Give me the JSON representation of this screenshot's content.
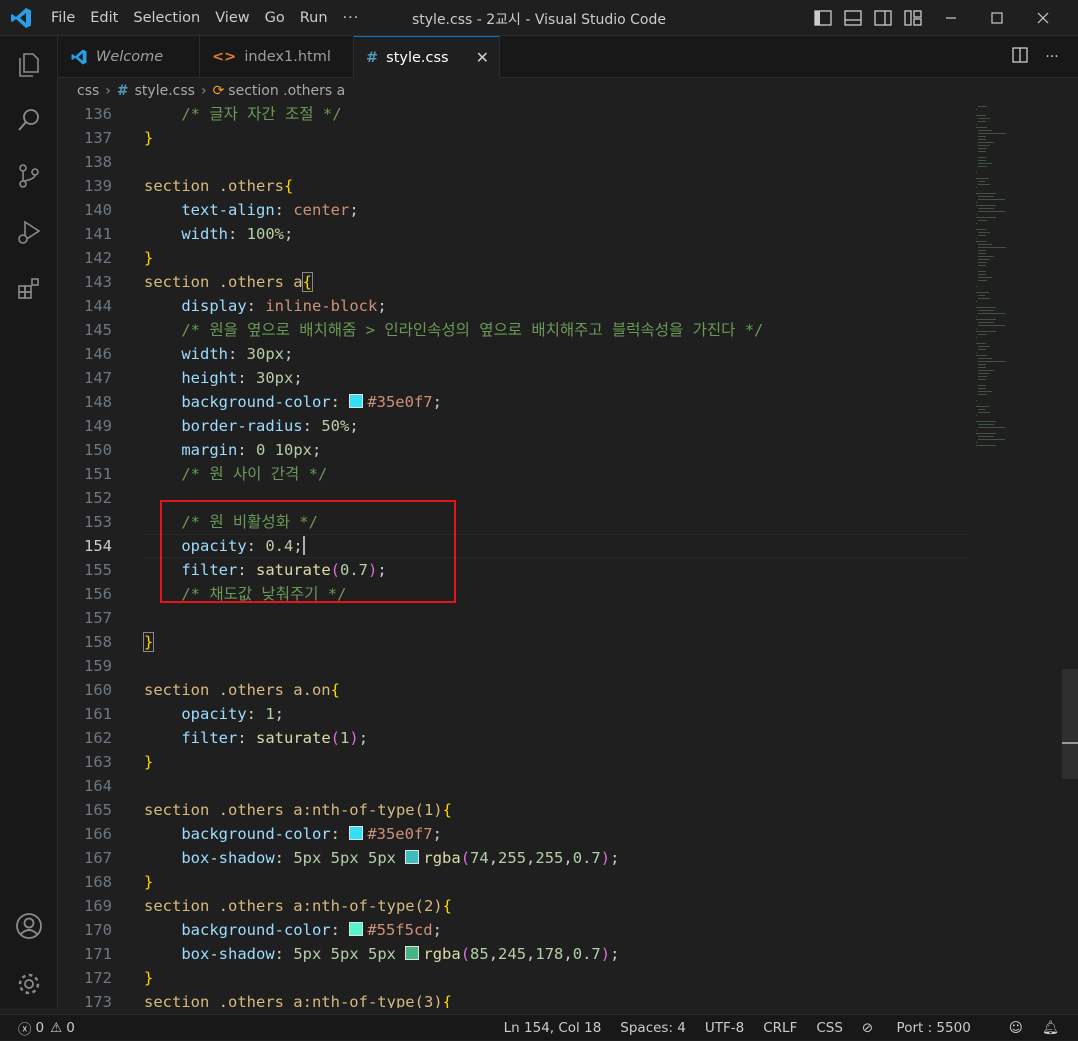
{
  "window": {
    "title": "style.css - 2교시 - Visual Studio Code"
  },
  "menu": [
    "File",
    "Edit",
    "Selection",
    "View",
    "Go",
    "Run",
    "···"
  ],
  "tabs": [
    {
      "label": "Welcome",
      "icon": "vscode-icon",
      "italic": true
    },
    {
      "label": "index1.html",
      "icon": "html-icon"
    },
    {
      "label": "style.css",
      "icon": "css-icon",
      "active": true
    }
  ],
  "breadcrumb": [
    "css",
    "style.css",
    "section .others a"
  ],
  "editor": {
    "current_line": 154,
    "lines": [
      {
        "n": "136",
        "html": "    <span class=\"cmt\">/* 글자 자간 조절 */</span>"
      },
      {
        "n": "137",
        "html": "<span class=\"br1\">}</span>"
      },
      {
        "n": "138",
        "html": ""
      },
      {
        "n": "139",
        "html": "<span class=\"sel\">section .others</span><span class=\"br1\">{</span>"
      },
      {
        "n": "140",
        "html": "    <span class=\"prop\">text-align</span>: <span class=\"val\">center</span>;"
      },
      {
        "n": "141",
        "html": "    <span class=\"prop\">width</span>: <span class=\"num\">100%</span>;"
      },
      {
        "n": "142",
        "html": "<span class=\"br1\">}</span>"
      },
      {
        "n": "143",
        "html": "<span class=\"sel\">section .others a</span><span class=\"br1 bracket-match\">{</span>"
      },
      {
        "n": "144",
        "html": "    <span class=\"prop\">display</span>: <span class=\"val\">inline-block</span>;"
      },
      {
        "n": "145",
        "html": "    <span class=\"cmt\">/* 원을 옆으로 배치해줌 &gt; 인라인속성의 옆으로 배치해주고 블럭속성을 가진다 */</span>"
      },
      {
        "n": "146",
        "html": "    <span class=\"prop\">width</span>: <span class=\"num\">30px</span>;"
      },
      {
        "n": "147",
        "html": "    <span class=\"prop\">height</span>: <span class=\"num\">30px</span>;"
      },
      {
        "n": "148",
        "html": "    <span class=\"prop\">background-color</span>: <span class=\"sw\" style=\"background:#35e0f7\"></span><span class=\"val\">#35e0f7</span>;"
      },
      {
        "n": "149",
        "html": "    <span class=\"prop\">border-radius</span>: <span class=\"num\">50%</span>;"
      },
      {
        "n": "150",
        "html": "    <span class=\"prop\">margin</span>: <span class=\"num\">0</span> <span class=\"num\">10px</span>;"
      },
      {
        "n": "151",
        "html": "    <span class=\"cmt\">/* 원 사이 간격 */</span>"
      },
      {
        "n": "152",
        "html": ""
      },
      {
        "n": "153",
        "html": "    <span class=\"cmt\">/* 원 비활성화 */</span>"
      },
      {
        "n": "154",
        "html": "    <span class=\"prop\">opacity</span>: <span class=\"num\">0.4</span>;<span class=\"caret\"></span>"
      },
      {
        "n": "155",
        "html": "    <span class=\"prop\">filter</span>: <span class=\"fn\">saturate</span><span class=\"br2\">(</span><span class=\"num\">0.7</span><span class=\"br2\">)</span>;"
      },
      {
        "n": "156",
        "html": "    <span class=\"cmt\">/* 채도값 낮춰주기 */</span>"
      },
      {
        "n": "157",
        "html": ""
      },
      {
        "n": "158",
        "html": "<span class=\"br1 bracket-match\">}</span>"
      },
      {
        "n": "159",
        "html": ""
      },
      {
        "n": "160",
        "html": "<span class=\"sel\">section .others a.on</span><span class=\"br1\">{</span>"
      },
      {
        "n": "161",
        "html": "    <span class=\"prop\">opacity</span>: <span class=\"num\">1</span>;"
      },
      {
        "n": "162",
        "html": "    <span class=\"prop\">filter</span>: <span class=\"fn\">saturate</span><span class=\"br2\">(</span><span class=\"num\">1</span><span class=\"br2\">)</span>;"
      },
      {
        "n": "163",
        "html": "<span class=\"br1\">}</span>"
      },
      {
        "n": "164",
        "html": ""
      },
      {
        "n": "165",
        "html": "<span class=\"sel\">section .others a:nth-of-type(1)</span><span class=\"br1\">{</span>"
      },
      {
        "n": "166",
        "html": "    <span class=\"prop\">background-color</span>: <span class=\"sw\" style=\"background:#35e0f7\"></span><span class=\"val\">#35e0f7</span>;"
      },
      {
        "n": "167",
        "html": "    <span class=\"prop\">box-shadow</span>: <span class=\"num\">5px</span> <span class=\"num\">5px</span> <span class=\"num\">5px</span> <span class=\"sw\" style=\"background:rgba(74,255,255,0.7)\"></span><span class=\"fn\">rgba</span><span class=\"br2\">(</span><span class=\"num\">74</span>,<span class=\"num\">255</span>,<span class=\"num\">255</span>,<span class=\"num\">0.7</span><span class=\"br2\">)</span>;"
      },
      {
        "n": "168",
        "html": "<span class=\"br1\">}</span>"
      },
      {
        "n": "169",
        "html": "<span class=\"sel\">section .others a:nth-of-type(2)</span><span class=\"br1\">{</span>"
      },
      {
        "n": "170",
        "html": "    <span class=\"prop\">background-color</span>: <span class=\"sw\" style=\"background:#55f5cd\"></span><span class=\"val\">#55f5cd</span>;"
      },
      {
        "n": "171",
        "html": "    <span class=\"prop\">box-shadow</span>: <span class=\"num\">5px</span> <span class=\"num\">5px</span> <span class=\"num\">5px</span> <span class=\"sw\" style=\"background:rgba(85,245,178,0.7)\"></span><span class=\"fn\">rgba</span><span class=\"br2\">(</span><span class=\"num\">85</span>,<span class=\"num\">245</span>,<span class=\"num\">178</span>,<span class=\"num\">0.7</span><span class=\"br2\">)</span>;"
      },
      {
        "n": "172",
        "html": "<span class=\"br1\">}</span>"
      },
      {
        "n": "173",
        "html": "<span class=\"sel\">section .others a:nth-of-type(3)</span><span class=\"br1\">{</span>"
      }
    ]
  },
  "status": {
    "errors": "0",
    "warnings": "0",
    "position": "Ln 154, Col 18",
    "spaces": "Spaces: 4",
    "encoding": "UTF-8",
    "eol": "CRLF",
    "language": "CSS",
    "port": "Port : 5500"
  },
  "colors": {
    "accent": "#0078d4",
    "highlight_box": "#e8141b"
  }
}
